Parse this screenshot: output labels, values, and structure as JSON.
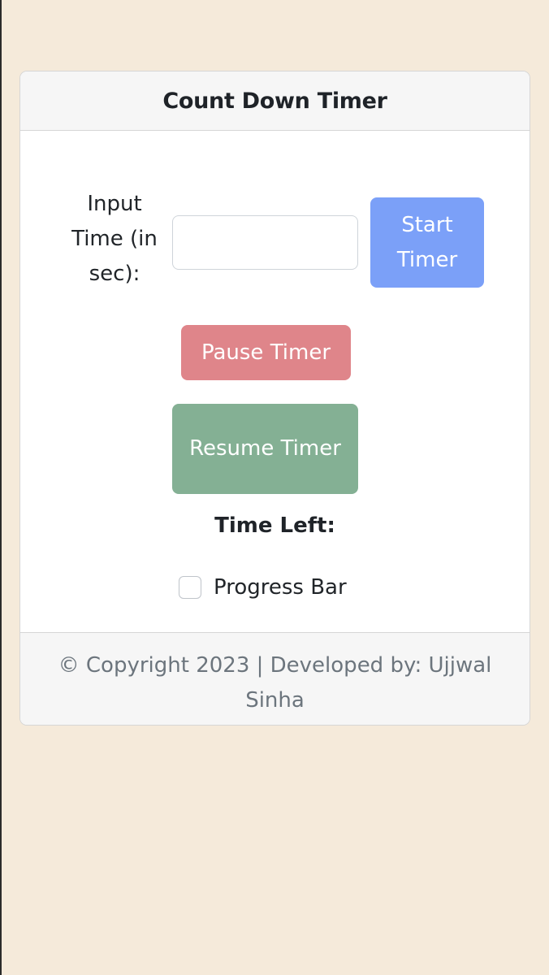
{
  "header": {
    "title": "Count Down Timer"
  },
  "form": {
    "input_label": "Input Time (in sec):",
    "input_value": "",
    "input_placeholder": ""
  },
  "buttons": {
    "start_label": "Start Timer",
    "pause_label": "Pause Timer",
    "resume_label": "Resume Timer"
  },
  "status": {
    "time_left_label": "Time Left:"
  },
  "progress": {
    "label": "Progress Bar",
    "checked": false
  },
  "footer": {
    "text": "© Copyright 2023 | Developed by: Ujjwal Sinha"
  },
  "colors": {
    "background": "#f5eada",
    "start_button": "#7ba0f8",
    "pause_button": "#df858a",
    "resume_button": "#84b094",
    "footer_text": "#6c757d"
  }
}
